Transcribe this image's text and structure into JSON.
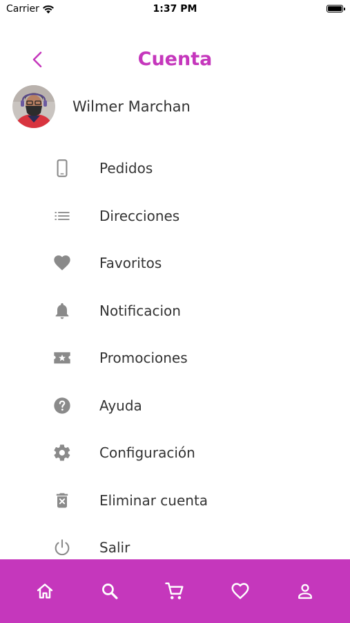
{
  "status_bar": {
    "carrier": "Carrier",
    "time": "1:37 PM"
  },
  "header": {
    "title": "Cuenta",
    "back_icon": "chevron-left-icon"
  },
  "profile": {
    "name": "Wilmer Marchan"
  },
  "menu": {
    "items": [
      {
        "label": "Pedidos",
        "icon": "phone-icon"
      },
      {
        "label": "Direcciones",
        "icon": "list-icon"
      },
      {
        "label": "Favoritos",
        "icon": "heart-icon"
      },
      {
        "label": "Notificacion",
        "icon": "bell-icon"
      },
      {
        "label": "Promociones",
        "icon": "ticket-star-icon"
      },
      {
        "label": "Ayuda",
        "icon": "help-circle-icon"
      },
      {
        "label": "Configuración",
        "icon": "gear-icon"
      },
      {
        "label": "Eliminar cuenta",
        "icon": "trash-icon"
      },
      {
        "label": "Salir",
        "icon": "power-icon"
      }
    ]
  },
  "bottom_nav": {
    "items": [
      {
        "icon": "home-icon"
      },
      {
        "icon": "search-icon"
      },
      {
        "icon": "cart-icon"
      },
      {
        "icon": "heart-outline-icon"
      },
      {
        "icon": "user-icon"
      }
    ]
  },
  "colors": {
    "accent": "#c537bc",
    "icon_gray": "#8a8a8a",
    "text": "#333333",
    "bottom_nav_bg": "#c537bc",
    "bottom_nav_icon": "#ffffff"
  }
}
